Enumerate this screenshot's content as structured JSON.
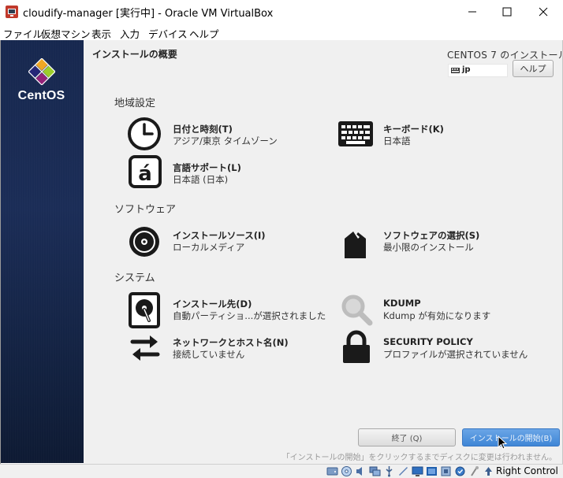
{
  "window": {
    "title": "cloudify-manager [実行中] - Oracle VM VirtualBox"
  },
  "menubar": {
    "items": [
      "ファイル",
      "仮想マシン",
      "表示",
      "入力",
      "デバイス",
      "ヘルプ"
    ]
  },
  "sidebar": {
    "brand": "CentOS"
  },
  "header": {
    "title": "インストールの概要",
    "product": "CENTOS 7 のインストール",
    "keyboard_layout": "jp",
    "help_label": "ヘルプ"
  },
  "sections": [
    {
      "title": "地域設定",
      "spokes": [
        {
          "title": "日付と時刻(T)",
          "status": "アジア/東京 タイムゾーン",
          "icon": "clock-icon"
        },
        {
          "title": "キーボード(K)",
          "status": "日本語",
          "icon": "keyboard-icon"
        },
        {
          "title": "言語サポート(L)",
          "status": "日本語 (日本)",
          "icon": "language-icon"
        }
      ]
    },
    {
      "title": "ソフトウェア",
      "spokes": [
        {
          "title": "インストールソース(I)",
          "status": "ローカルメディア",
          "icon": "disc-icon"
        },
        {
          "title": "ソフトウェアの選択(S)",
          "status": "最小限のインストール",
          "icon": "package-icon"
        }
      ]
    },
    {
      "title": "システム",
      "spokes": [
        {
          "title": "インストール先(D)",
          "status": "自動パーティショ...が選択されました",
          "icon": "harddisk-icon"
        },
        {
          "title": "KDUMP",
          "status": "Kdump が有効になります",
          "icon": "magnifier-icon"
        },
        {
          "title": "ネットワークとホスト名(N)",
          "status": "接続していません",
          "icon": "network-icon"
        },
        {
          "title": "SECURITY POLICY",
          "status": "プロファイルが選択されていません",
          "icon": "lock-icon"
        }
      ]
    }
  ],
  "footer": {
    "quit_label": "終了 (Q)",
    "begin_label": "インストールの開始(B)",
    "notice": "「インストールの開始」をクリックするまでディスクに変更は行われません。"
  },
  "statusbar": {
    "host_key": "Right Control"
  },
  "colors": {
    "sidebar": "#1b2d57",
    "primary_button": "#3f86d6",
    "panel": "#f0f0f0"
  }
}
